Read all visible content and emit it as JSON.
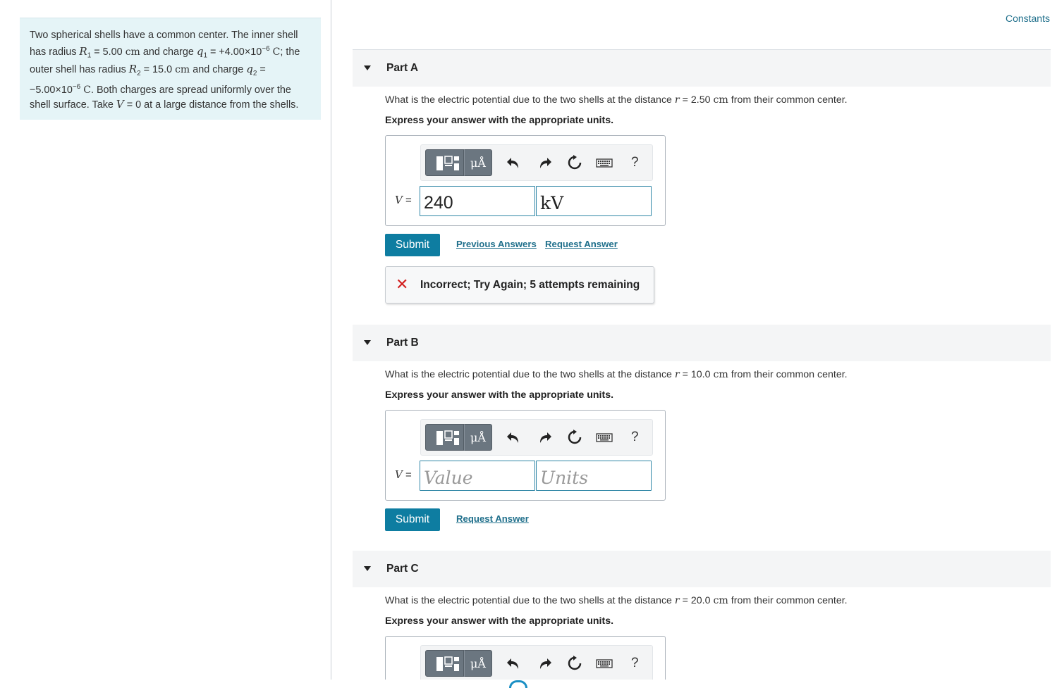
{
  "problem": {
    "p1": "Two spherical shells have a common center. The inner shell has radius",
    "R1_sym": "R",
    "R1_sub": "1",
    "R1_val": "= 5.00",
    "R1_unit": "cm",
    "and_charge": "and charge",
    "q1_sym": "q",
    "q1_sub": "1",
    "q1_val": "= +4.00×10",
    "q1_exp": "−6",
    "q1_unit": "C",
    "semicolon": ";",
    "p2": "the outer shell has radius",
    "R2_sym": "R",
    "R2_sub": "2",
    "R2_val": "= 15.0",
    "R2_unit": "cm",
    "and_charge2": "and charge",
    "q2_sym": "q",
    "q2_sub": "2",
    "q2_val": "= −5.00×10",
    "q2_exp": "−6",
    "q2_unit": "C",
    "p3": ". Both charges are spread uniformly over the shell surface. Take",
    "V_sym": "V",
    "p4": "= 0 at a large distance from the shells."
  },
  "constants_link": "Constants",
  "parts": [
    {
      "title": "Part A",
      "q_pre": "What is the electric potential due to the two shells at the distance",
      "r_sym": "r",
      "r_val": "= 2.50",
      "r_unit": "cm",
      "q_post": "from their common center.",
      "instruction": "Express your answer with the appropriate units.",
      "v_label_sym": "V",
      "v_label_eq": " =",
      "value": "240",
      "units": "kV",
      "submit": "Submit",
      "prev_answers": "Previous Answers",
      "request_answer": "Request Answer",
      "feedback_icon": "✕",
      "feedback": "Incorrect; Try Again; 5 attempts remaining"
    },
    {
      "title": "Part B",
      "q_pre": "What is the electric potential due to the two shells at the distance",
      "r_sym": "r",
      "r_val": "= 10.0",
      "r_unit": "cm",
      "q_post": "from their common center.",
      "instruction": "Express your answer with the appropriate units.",
      "v_label_sym": "V",
      "v_label_eq": " =",
      "value_placeholder": "Value",
      "units_placeholder": "Units",
      "submit": "Submit",
      "request_answer": "Request Answer"
    },
    {
      "title": "Part C",
      "q_pre": "What is the electric potential due to the two shells at the distance",
      "r_sym": "r",
      "r_val": "= 20.0",
      "r_unit": "cm",
      "q_post": "from their common center.",
      "instruction": "Express your answer with the appropriate units."
    }
  ],
  "toolbar": {
    "units_symbol": "μÅ",
    "help": "?",
    "icons": [
      "templates-icon",
      "units-icon",
      "undo-icon",
      "redo-icon",
      "reset-icon",
      "keyboard-icon",
      "help-icon"
    ]
  },
  "colors": {
    "accent": "#0e7da1",
    "link": "#1f6f8b",
    "problem_bg": "#e5f4f7",
    "error": "#d21f1f"
  }
}
